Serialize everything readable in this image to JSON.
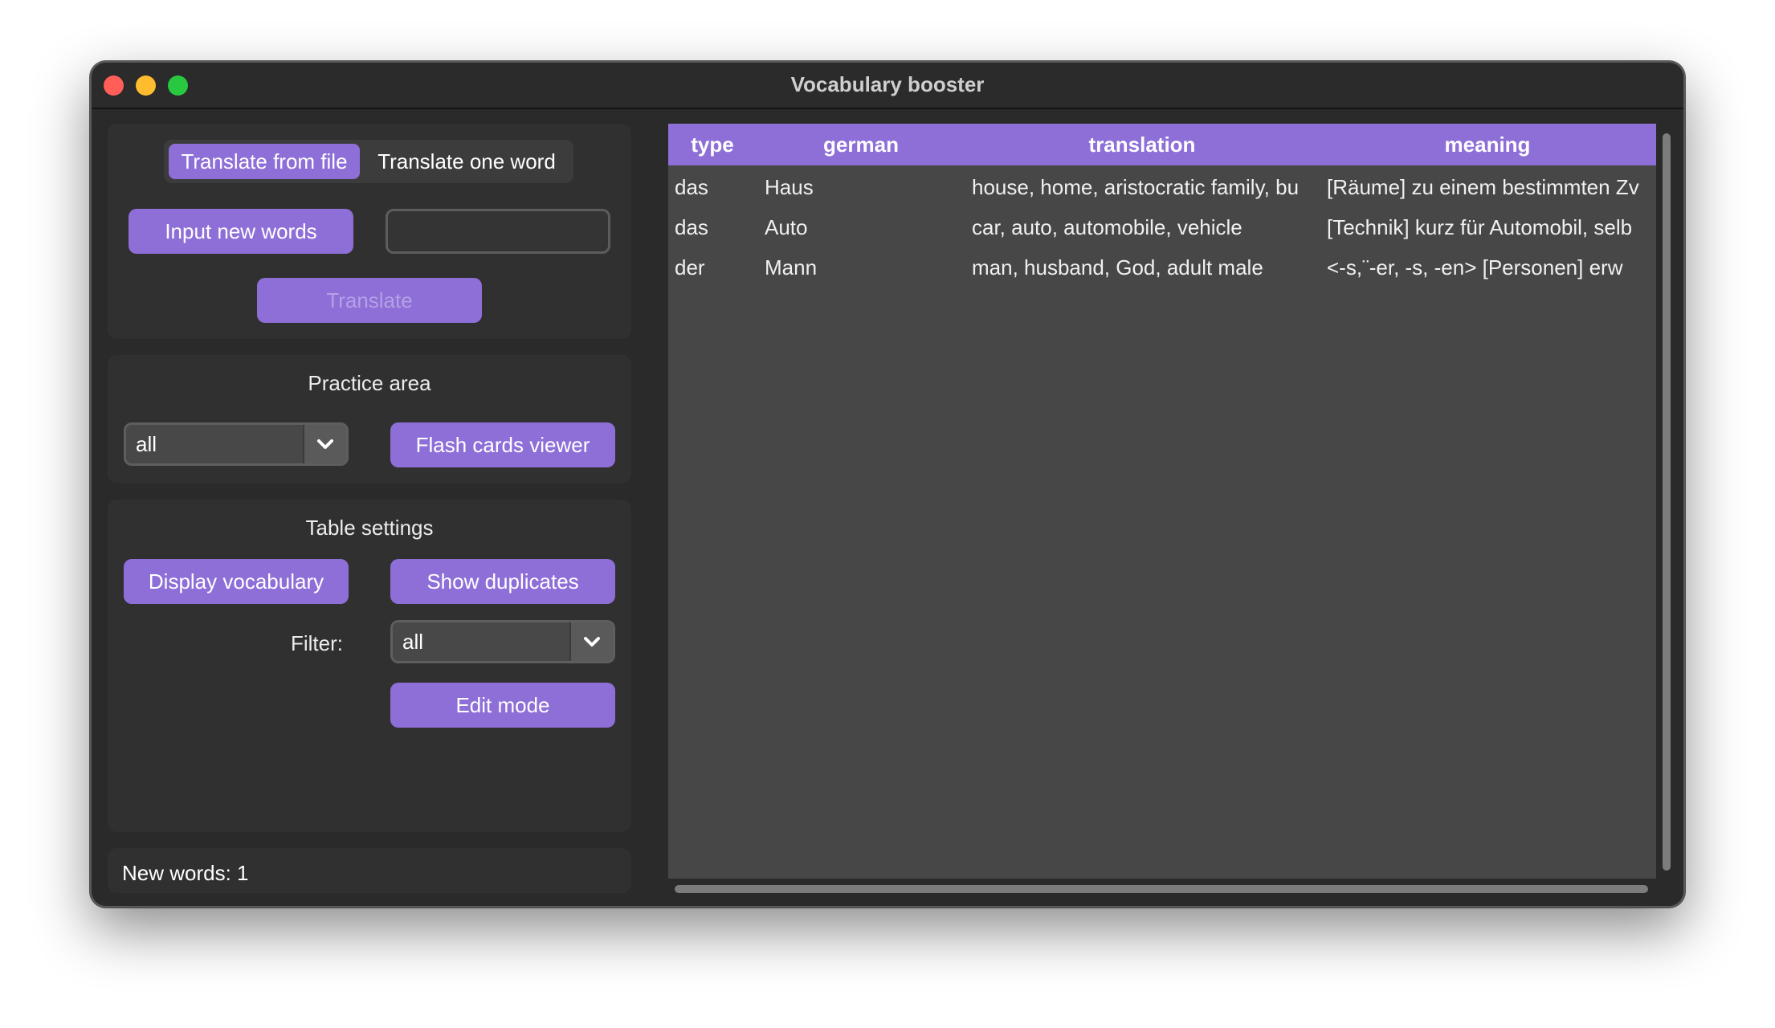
{
  "window": {
    "title": "Vocabulary booster"
  },
  "translate_section": {
    "mode_tabs": [
      {
        "label": "Translate from file",
        "active": true
      },
      {
        "label": "Translate one word",
        "active": false
      }
    ],
    "input_button_label": "Input new words",
    "word_input_value": "",
    "translate_button_label": "Translate"
  },
  "practice_section": {
    "title": "Practice area",
    "filter_selected": "all",
    "flash_cards_label": "Flash cards viewer"
  },
  "table_settings": {
    "title": "Table settings",
    "display_label": "Display vocabulary",
    "duplicates_label": "Show duplicates",
    "filter_label": "Filter:",
    "filter_selected": "all",
    "edit_mode_label": "Edit mode"
  },
  "status_bar": {
    "text": "New words: 1"
  },
  "table": {
    "columns": [
      "type",
      "german",
      "translation",
      "meaning"
    ],
    "rows": [
      [
        "das",
        "Haus",
        "house, home, aristocratic family, bu",
        "[Räume] zu einem bestimmten Zv"
      ],
      [
        "das",
        "Auto",
        "car, auto, automobile, vehicle",
        "[Technik] kurz für Automobil, selb"
      ],
      [
        "der",
        "Mann",
        "man, husband, God, adult male",
        "<-s,¨-er, -s, -en> [Personen] erw"
      ]
    ]
  },
  "colors": {
    "accent": "#8e6fd8",
    "window_bg": "#2a2a2a",
    "panel_bg": "#303030",
    "table_bg": "#474747"
  }
}
